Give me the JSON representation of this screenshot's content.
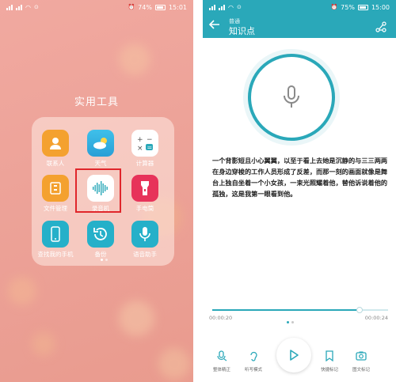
{
  "left_phone": {
    "status": {
      "carrier": "⁴⁶ᵢₗₗ ⁴⁶ᵢₗₗ",
      "battery_pct": "74%",
      "time": "15:01"
    },
    "folder_title": "实用工具",
    "apps": [
      {
        "label": "联系人",
        "icon": "contacts-icon",
        "color": "#f4a12f"
      },
      {
        "label": "天气",
        "icon": "weather-icon",
        "color": "#34b6e4"
      },
      {
        "label": "计算器",
        "icon": "calculator-icon",
        "color": "#ffffff"
      },
      {
        "label": "文件管理",
        "icon": "folder-icon",
        "color": "#f4a12f"
      },
      {
        "label": "录音机",
        "icon": "recorder-icon",
        "color": "#ffffff"
      },
      {
        "label": "手电筒",
        "icon": "flashlight-icon",
        "color": "#e7335a"
      },
      {
        "label": "查找我的手机",
        "icon": "find-phone-icon",
        "color": "#25b0c9"
      },
      {
        "label": "备份",
        "icon": "backup-icon",
        "color": "#25b0c9"
      },
      {
        "label": "语音助手",
        "icon": "voice-assistant-icon",
        "color": "#25b0c9"
      }
    ]
  },
  "right_phone": {
    "status": {
      "battery_pct": "75%",
      "time": "15:00"
    },
    "header": {
      "subtitle": "普通",
      "title": "知识点"
    },
    "accent": "#2aa8b9",
    "transcript": "一个背影短且小心翼翼，以至于看上去她是沉静的与三三两两在身边穿梭的工作人员形成了反差，而那一刻的画面就像是舞台上独自坐着一个小女孩，一束光照耀着他，替他诉说着他的孤独，这是我第一眼看到他。",
    "player": {
      "current": "00:00:20",
      "total": "00:00:24",
      "progress": 0.84
    },
    "controls": {
      "left1": "整体精正",
      "left2": "听写模式",
      "right1": "快捷标记",
      "right2": "图文标记"
    }
  }
}
